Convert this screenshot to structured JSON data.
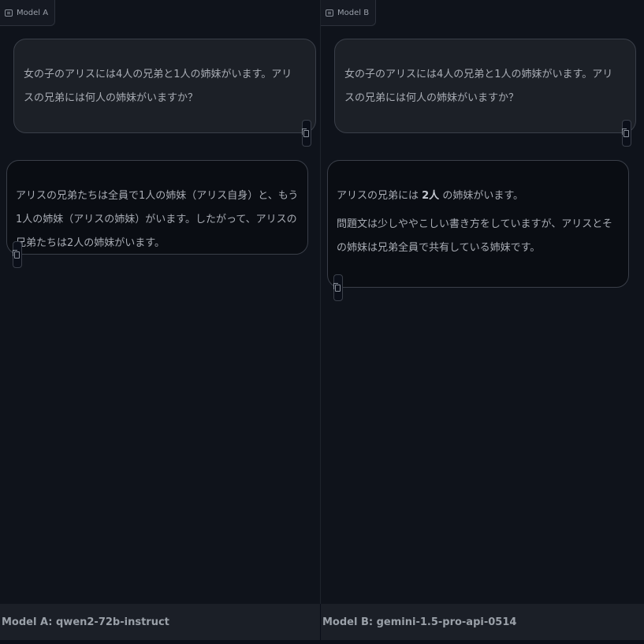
{
  "panel_a": {
    "tag": "Model A",
    "user_message": "女の子のアリスには4人の兄弟と1人の姉妹がいます。アリスの兄弟には何人の姉妹がいますか？",
    "bot_message": "アリスの兄弟たちは全員で1人の姉妹（アリス自身）と、もう1人の姉妹（アリスの姉妹）がいます。したがって、アリスの兄弟たちは2人の姉妹がいます。",
    "footer": "Model A: qwen2-72b-instruct"
  },
  "panel_b": {
    "tag": "Model B",
    "user_message": "女の子のアリスには4人の兄弟と1人の姉妹がいます。アリスの兄弟には何人の姉妹がいますか？",
    "bot_line1_prefix": "アリスの兄弟には ",
    "bot_line1_bold": "2人",
    "bot_line1_suffix": " の姉妹がいます。",
    "bot_line2": "問題文は少しややこしい書き方をしていますが、アリスとその姉妹は兄弟全員で共有している姉妹です。",
    "footer": "Model B: gemini-1.5-pro-api-0514"
  },
  "icons": {
    "tag_icon": "chat-icon",
    "copy_icon": "copy-icon"
  }
}
